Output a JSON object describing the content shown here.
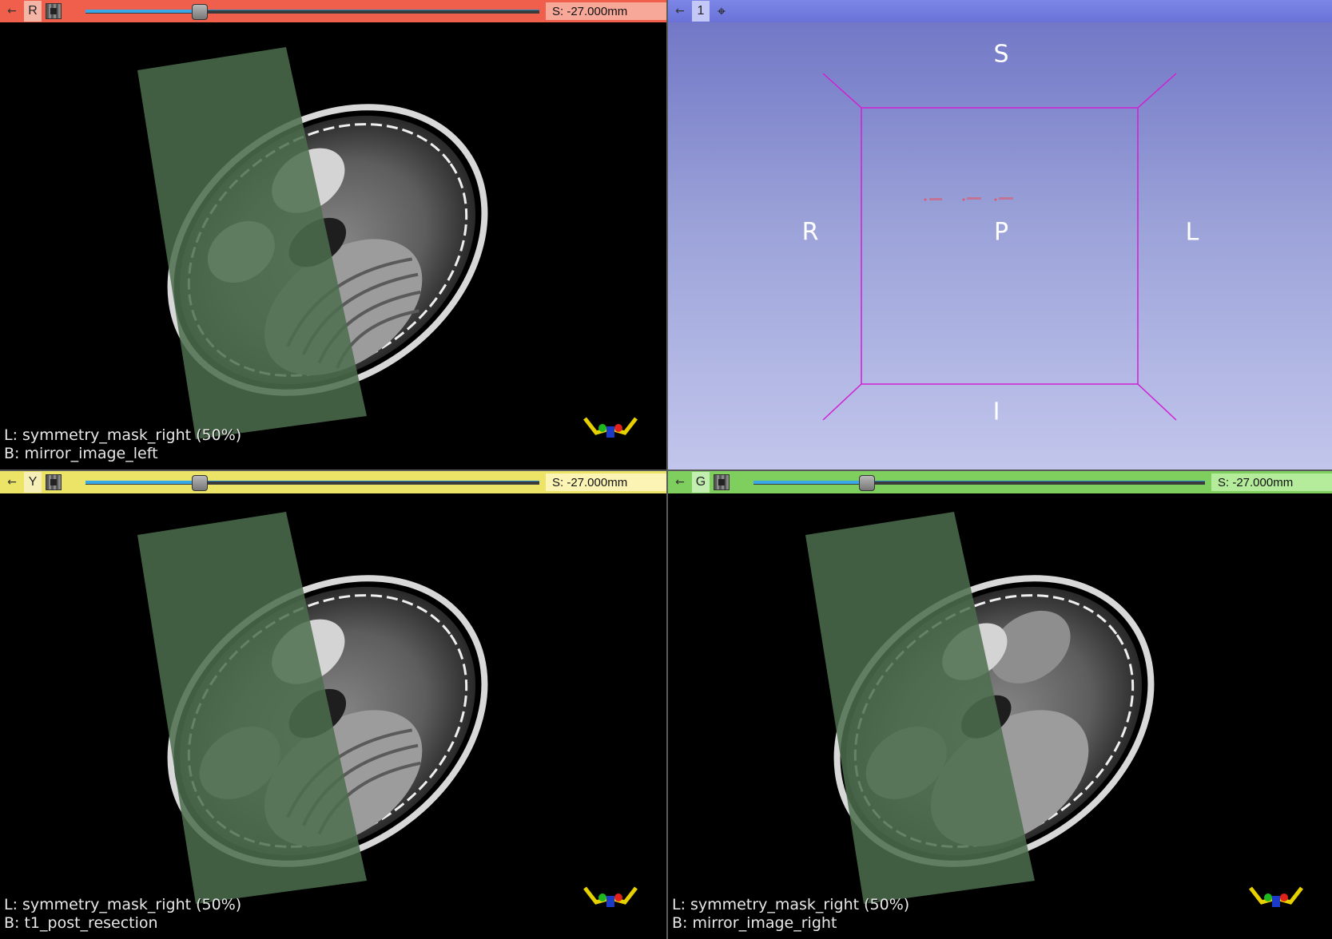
{
  "views": {
    "red": {
      "letter": "R",
      "offset": "S: -27.000mm",
      "slider_fraction": 0.25,
      "label_line": "L: symmetry_mask_right (50%)",
      "background_line": "B: mirror_image_left",
      "bar_color": "#f05f4b"
    },
    "threed": {
      "letter": "1",
      "axis_S": "S",
      "axis_R": "R",
      "axis_P": "P",
      "axis_L": "L",
      "axis_I": "I",
      "bar_color": "#6a72d8"
    },
    "yellow": {
      "letter": "Y",
      "offset": "S: -27.000mm",
      "slider_fraction": 0.25,
      "label_line": "L: symmetry_mask_right (50%)",
      "background_line": "B: t1_post_resection",
      "bar_color": "#ece466"
    },
    "green": {
      "letter": "G",
      "offset": "S: -27.000mm",
      "slider_fraction": 0.25,
      "label_line": "L: symmetry_mask_right (50%)",
      "background_line": "B: mirror_image_right",
      "bar_color": "#7fcf5f"
    }
  },
  "icons": {
    "pin": "pin-icon",
    "lock": "link-lock-icon",
    "gear": "view-settings-icon",
    "orientation": "orientation-marker-icon"
  },
  "overlay_color": "#4e6e4e"
}
